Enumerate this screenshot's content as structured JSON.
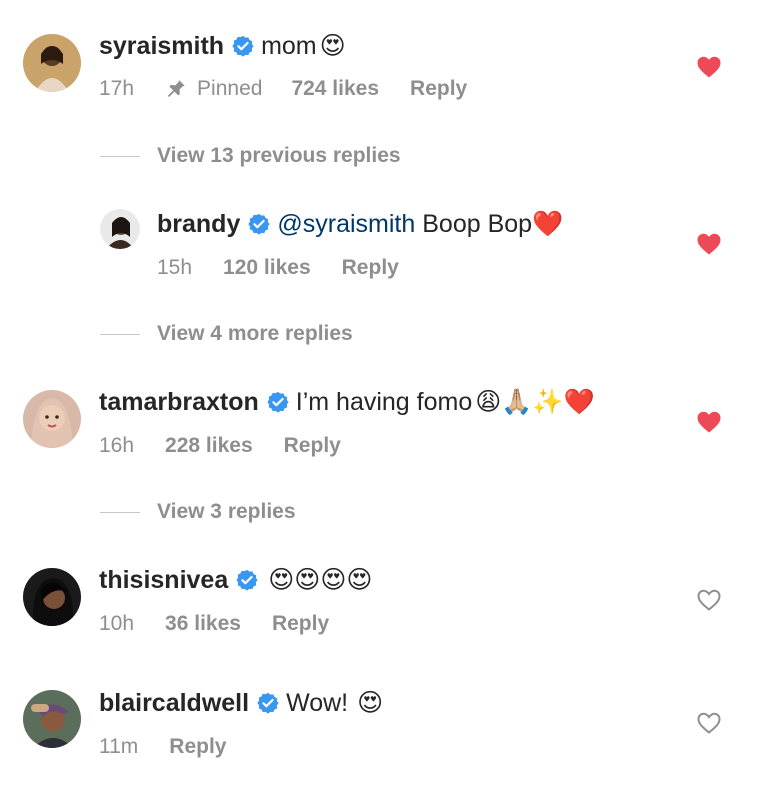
{
  "comments": [
    {
      "username": "syraismith",
      "mention": "",
      "text": "mom",
      "emoji": "😍",
      "time": "17h",
      "pinned_label": "Pinned",
      "likes": "724 likes",
      "reply": "Reply",
      "liked": true
    },
    {
      "username": "brandy",
      "mention": "@syraismith",
      "text": "Boop Bop",
      "emoji": "❤️",
      "time": "15h",
      "likes": "120 likes",
      "reply": "Reply",
      "liked": true
    },
    {
      "username": "tamarbraxton",
      "mention": "",
      "text": "I’m having fomo",
      "emoji": "😩🙏🏼✨❤️",
      "time": "16h",
      "likes": "228 likes",
      "reply": "Reply",
      "liked": true
    },
    {
      "username": "thisisnivea",
      "mention": "",
      "text": "",
      "emoji": "😍😍😍😍",
      "time": "10h",
      "likes": "36 likes",
      "reply": "Reply",
      "liked": false
    },
    {
      "username": "blaircaldwell",
      "mention": "",
      "text": "Wow!",
      "emoji": "😍",
      "time": "11m",
      "likes": "",
      "reply": "Reply",
      "liked": false
    }
  ],
  "view_replies": [
    "View 13 previous replies",
    "View 4 more replies",
    "View 3 replies"
  ],
  "colors": {
    "liked_heart": "#ed4956",
    "verified_badge": "#3897f0",
    "mention": "#00376b",
    "secondary_text": "#8e8e8e"
  },
  "icons": {
    "verified": "verified-badge-icon",
    "pin": "pin-icon",
    "heart_filled": "heart-filled-icon",
    "heart_outline": "heart-outline-icon"
  }
}
